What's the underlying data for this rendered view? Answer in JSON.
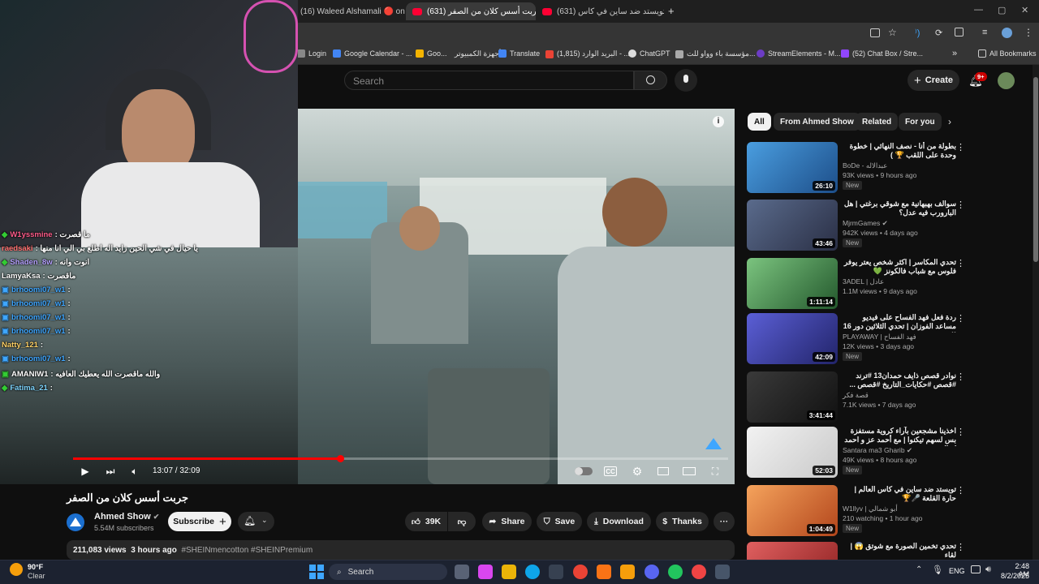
{
  "browser": {
    "tabs": [
      {
        "label": "(16) Waleed Alshamali 🔴 on X",
        "close": "✕"
      },
      {
        "label": "(631) جربت أسس كلان من الصفر",
        "close": "✕"
      },
      {
        "label": "(631) تويستد ضد ساين في كاس",
        "close": "✕"
      }
    ],
    "new_tab": "+",
    "window_controls": [
      "—",
      "▢",
      "✕"
    ],
    "bookmarks": [
      "Login",
      "Google Calendar - ...",
      "Goo...",
      "أجهزة الكمبيوتر",
      "Translate",
      "(1,815) البريد الوارد - ...",
      "ChatGPT",
      "مؤسسة باء وواو للت...",
      "StreamElements - M...",
      "(52) Chat Box / Stre...",
      "»",
      "All Bookmarks"
    ],
    "colors": {
      "youtube_red": "#ff0033",
      "accent_blue": "#3ea6ff"
    }
  },
  "youtube": {
    "search_placeholder": "Search",
    "create_label": "Create",
    "notif_badge": "9+"
  },
  "stream_chat": [
    {
      "user": "W1yssmine",
      "msg": ": ما قصرت",
      "color": "#ff5c8a"
    },
    {
      "user": "raedsaki",
      "msg": ": يا حيال في شي الحين زايد اله اطلع بي الي انا منها",
      "color": "#ff6f6f"
    },
    {
      "user": "Shaden_8w",
      "msg": ": انوت وانه",
      "color": "#b6a1ff"
    },
    {
      "user": "LamyaKsa",
      "msg": ": ماقصرت",
      "color": "#ffffff"
    },
    {
      "user": "brhoomi07_w1",
      "msg": ":",
      "color": "#3ea6ff"
    },
    {
      "user": "brhoomi07_w1",
      "msg": ":",
      "color": "#3ea6ff"
    },
    {
      "user": "brhoomi07_w1",
      "msg": ":",
      "color": "#3ea6ff"
    },
    {
      "user": "brhoomi07_w1",
      "msg": ":",
      "color": "#3ea6ff"
    },
    {
      "user": "Natty_121",
      "msg": ":",
      "color": "#ffd166"
    },
    {
      "user": "brhoomi07_w1",
      "msg": ":",
      "color": "#3ea6ff"
    },
    {
      "user": "AMANIW1",
      "msg": ": والله ماقصرت الله يعطيك العافيه",
      "color": "#ffffff"
    },
    {
      "user": "Fatima_21",
      "msg": ":",
      "color": "#7dd3fc"
    }
  ],
  "player": {
    "time": "13:07 / 32:09",
    "progress": 0.408
  },
  "video": {
    "title": "جربت أسس كلان من الصفر",
    "channel": "Ahmed Show",
    "verified": "✔",
    "subscribers": "5.54M subscribers",
    "subscribe_label": "Subscribe",
    "likes": "39K",
    "share_label": "Share",
    "save_label": "Save",
    "download_label": "Download",
    "thanks_label": "Thanks",
    "more_label": "···",
    "views": "211,083 views",
    "date": "3 hours ago",
    "hashtags": "#SHEINmencotton #SHEINPremium"
  },
  "chips": [
    "All",
    "From Ahmed Show",
    "Related",
    "For you"
  ],
  "recommendations": [
    {
      "title": "بطولة من أنا - نصف النهائي | خطوة وحدة على اللقب 🏆 )",
      "channel": "BoDe - عبدالاله",
      "meta": "93K views • 9 hours ago",
      "badge": "New",
      "duration": "26:10",
      "thumb": "#2b6cb0"
    },
    {
      "title": "سوالف بهبهانية مع شوقي برغتي | هل البارورب فيه عدل؟",
      "channel": "MjrmGames ✔",
      "meta": "942K views • 4 days ago",
      "badge": "New",
      "duration": "43:46",
      "thumb": "#333c55"
    },
    {
      "title": "تحدي المكاسر | اكثر شخص يعتر يوفر فلوس مع شباب فالكونز 💚",
      "channel": "3ADEL | عادل",
      "meta": "1.1M views • 9 days ago",
      "badge": "",
      "duration": "1:11:14",
      "thumb": "#3c7a4a"
    },
    {
      "title": "ردة فعل فهد الفساح على فيديو مساعد الفوزان | تحدي الثلاثين دور 16 !!",
      "channel": "PLAYAWAY | فهد الفساح",
      "meta": "12K views • 3 days ago",
      "badge": "New",
      "duration": "42:09",
      "thumb": "#3b3fa0"
    },
    {
      "title": "نوادر قصص ذايف حمدان13 #ترند #قصص #حكايات_التاريخ #قصص ...",
      "channel": "قصة فكر",
      "meta": "7.1K views • 7 days ago",
      "badge": "",
      "duration": "3:41:44",
      "thumb": "#222"
    },
    {
      "title": "اخذينا مشجعين بآراء كروية مستفزة بس لسهم تيكنوا | مع أحمد عز و احمد كمال",
      "channel": "Santara ma3 Gharib ✔",
      "meta": "49K views • 8 hours ago",
      "badge": "New",
      "duration": "52:03",
      "thumb": "#e8e8e8"
    },
    {
      "title": "تويستد ضد ساين في كاس العالم | حارة القلعة 🎤🏆",
      "channel": "W1llyv | أبو شمالي",
      "meta": "210 watching • 1 hour ago",
      "badge": "New",
      "duration": "1:04:49",
      "thumb": "#d96b2b"
    },
    {
      "title": "تحدي تخمين الصورة مع شوتق 😱 | لقاء",
      "channel": "",
      "meta": "",
      "badge": "",
      "duration": "",
      "thumb": "#c0392b"
    }
  ],
  "taskbar": {
    "weather_temp": "90°F",
    "weather_desc": "Clear",
    "search_label": "Search",
    "lang": "ENG",
    "time": "2:48 AM",
    "date": "8/2/2025"
  }
}
